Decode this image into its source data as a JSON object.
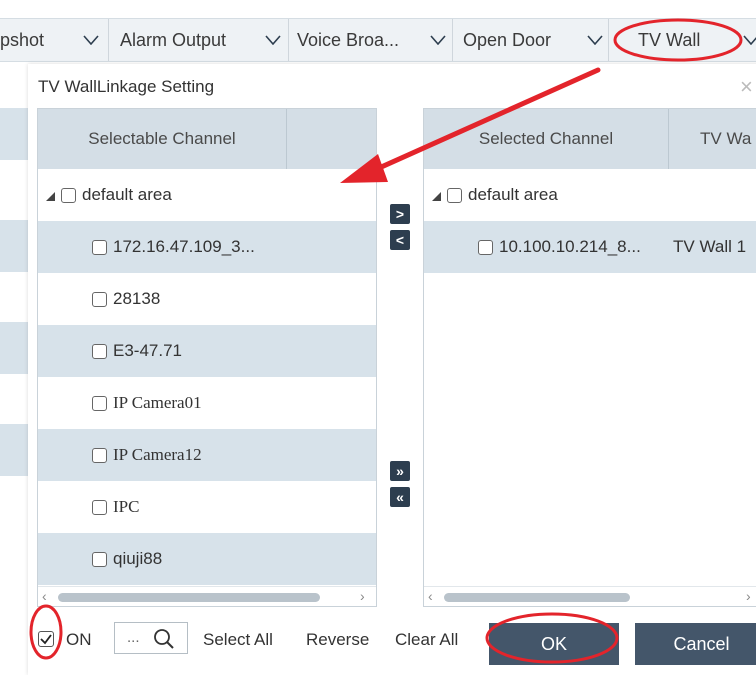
{
  "toolbar": {
    "tabs": [
      {
        "label": "pshot"
      },
      {
        "label": "Alarm Output"
      },
      {
        "label": "Voice Broa..."
      },
      {
        "label": "Open Door"
      },
      {
        "label": "TV Wall"
      }
    ]
  },
  "dialog": {
    "title": "TV WallLinkage Setting",
    "close_glyph": "×",
    "left": {
      "header": "Selectable Channel",
      "root": "default area",
      "items": [
        "172.16.47.109_3...",
        "28138",
        "E3-47.71",
        "IP Camera01",
        "IP Camera12",
        "IPC",
        "qiuji88"
      ]
    },
    "right": {
      "header_channel": "Selected Channel",
      "header_tvwall": "TV Wa",
      "root": "default area",
      "items": [
        {
          "channel": "10.100.10.214_8...",
          "tvwall": "TV Wall 1"
        }
      ]
    },
    "move": {
      "add_one": ">",
      "remove_one": "<",
      "add_all": "»",
      "remove_all": "«"
    },
    "bottom": {
      "on_checked": "true",
      "on_label": "ON",
      "browse_label": "...",
      "select_all": "Select All",
      "reverse": "Reverse",
      "clear_all": "Clear All",
      "ok": "OK",
      "cancel": "Cancel"
    }
  },
  "annotation": {
    "color": "#e3242b"
  }
}
